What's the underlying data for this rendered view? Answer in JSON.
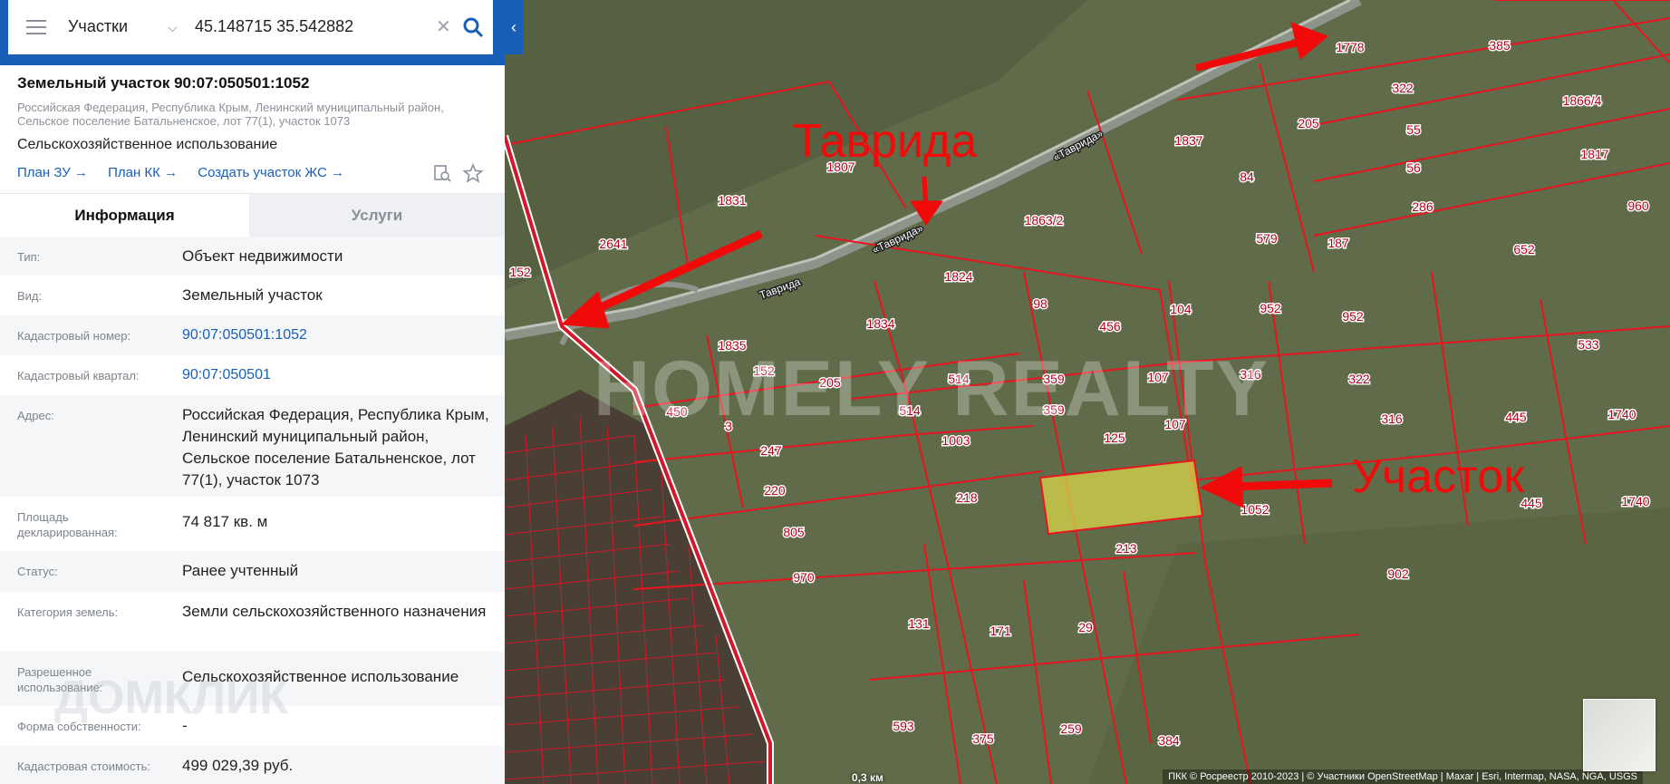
{
  "search": {
    "layer": "Участки",
    "query": "45.148715 35.542882"
  },
  "plot": {
    "title": "Земельный участок 90:07:050501:1052",
    "address_small": "Российская Федерация, Республика Крым, Ленинский муниципальный район, Сельское поселение Батальненское, лот 77(1), участок 1073",
    "usage": "Сельскохозяйственное использование"
  },
  "links": [
    "План ЗУ →",
    "План КК →",
    "Создать участок ЖС →"
  ],
  "tabs": {
    "info": "Информация",
    "services": "Услуги"
  },
  "info_rows": [
    {
      "label": "Тип:",
      "value": "Объект недвижимости"
    },
    {
      "label": "Вид:",
      "value": "Земельный участок"
    },
    {
      "label": "Кадастровый номер:",
      "value": "90:07:050501:1052"
    },
    {
      "label": "Кадастровый квартал:",
      "value": "90:07:050501"
    },
    {
      "label": "Адрес:",
      "value": "Российская Федерация, Республика Крым, Ленинский муниципальный район, Сельское поселение Батальненское, лот 77(1), участок 1073"
    },
    {
      "label": "Площадь декларированная:",
      "value": "74 817 кв. м"
    },
    {
      "label": "Статус:",
      "value": "Ранее учтенный"
    },
    {
      "label": "Категория земель:",
      "value": "Земли сельскохозяйственного назначения"
    },
    {
      "label": "Разрешенное использование:",
      "value": "Сельскохозяйственное использование"
    },
    {
      "label": "Форма собственности:",
      "value": "-"
    },
    {
      "label": "Кадастровая стоимость:",
      "value": "499 029,39 руб."
    }
  ],
  "map": {
    "annotations": {
      "road": "Таврида",
      "plot": "Участок"
    },
    "road_labels": [
      "«Таврида»",
      "«Таврида»",
      "Таврида"
    ],
    "watermark": "HOMELY REALTY",
    "watermark_sidebar": "ДОМКЛИК",
    "scale": "0,3 км",
    "attribution": "ПКК © Росреестр 2010-2023 | © Участники OpenStreetMap | Maxar | Esri, Intermap, NASA, NGA, USGS",
    "highlight_color": "#d8d64a",
    "boundary_color": "#e8141f",
    "plot_numbers": [
      "1778",
      "322",
      "55",
      "56",
      "286",
      "84",
      "579",
      "1837",
      "1807",
      "1831",
      "2641",
      "1863/2",
      "1824",
      "98",
      "456",
      "104",
      "952",
      "952",
      "1834",
      "1835",
      "152",
      "205",
      "514",
      "359",
      "107",
      "316",
      "514",
      "359",
      "107",
      "316",
      "1003",
      "125",
      "1052",
      "247",
      "220",
      "218",
      "213",
      "805",
      "970",
      "131",
      "171",
      "29",
      "902",
      "593",
      "375",
      "259",
      "384",
      "385",
      "1866/4",
      "1817",
      "960",
      "652",
      "533",
      "135",
      "445",
      "1740",
      "445",
      "1740",
      "450",
      "3",
      "152",
      "205",
      "187",
      "322",
      "579",
      "316"
    ]
  }
}
